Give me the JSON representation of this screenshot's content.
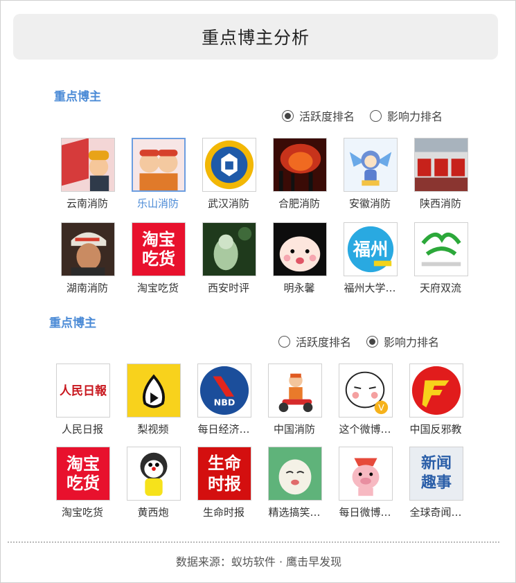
{
  "header": {
    "title": "重点博主分析"
  },
  "section1": {
    "title": "重点博主",
    "radios": [
      {
        "label": "活跃度排名",
        "checked": true
      },
      {
        "label": "影响力排名",
        "checked": false
      }
    ],
    "items": [
      {
        "name": "云南消防",
        "icon": "firefighter-cartoon-icon",
        "active": false
      },
      {
        "name": "乐山消防",
        "icon": "firefighter-mascots-icon",
        "active": true
      },
      {
        "name": "武汉消防",
        "icon": "wuhan-fire-badge-icon",
        "active": false
      },
      {
        "name": "合肥消防",
        "icon": "fire-scene-photo-icon",
        "active": false
      },
      {
        "name": "安徽消防",
        "icon": "blue-mascot-icon",
        "active": false
      },
      {
        "name": "陕西消防",
        "icon": "fire-trucks-photo-icon",
        "active": false
      },
      {
        "name": "湖南消防",
        "icon": "firefighter-portrait-icon",
        "active": false
      },
      {
        "name": "淘宝吃货",
        "icon": "taobao-chihuo-logo-icon",
        "active": false
      },
      {
        "name": "西安时评",
        "icon": "jade-buddha-icon",
        "active": false
      },
      {
        "name": "明永馨",
        "icon": "cartoon-face-icon",
        "active": false
      },
      {
        "name": "福州大学…",
        "icon": "fuzhou-logo-icon",
        "active": false
      },
      {
        "name": "天府双流",
        "icon": "shuangliu-logo-icon",
        "active": false
      }
    ]
  },
  "section2": {
    "title": "重点博主",
    "radios": [
      {
        "label": "活跃度排名",
        "checked": false
      },
      {
        "label": "影响力排名",
        "checked": true
      }
    ],
    "items": [
      {
        "name": "人民日报",
        "icon": "peoples-daily-logo-icon"
      },
      {
        "name": "梨视频",
        "icon": "pear-video-logo-icon"
      },
      {
        "name": "每日经济…",
        "icon": "nbd-logo-icon"
      },
      {
        "name": "中国消防",
        "icon": "firefighter-scooter-icon"
      },
      {
        "name": "这个微博…",
        "icon": "cartoon-face-v-icon"
      },
      {
        "name": "中国反邪教",
        "icon": "anti-cult-logo-icon"
      },
      {
        "name": "淘宝吃货",
        "icon": "taobao-chihuo-logo-icon"
      },
      {
        "name": "黄西炮",
        "icon": "doraemon-icon"
      },
      {
        "name": "生命时报",
        "icon": "life-times-logo-icon"
      },
      {
        "name": "精选搞笑…",
        "icon": "funny-cartoon-icon"
      },
      {
        "name": "每日微博…",
        "icon": "pig-cartoon-icon"
      },
      {
        "name": "全球奇闻…",
        "icon": "strange-news-logo-icon"
      }
    ],
    "logo_text": {
      "taobao_1": "淘宝",
      "taobao_2": "吃货",
      "nbd": "NBD",
      "life_1": "生命",
      "life_2": "时报",
      "news_1": "新闻",
      "news_2": "趣事",
      "peoples_daily": "人民日報"
    }
  },
  "footer": {
    "text": "数据来源：蚁坊软件 · 鹰击早发现"
  },
  "colors": {
    "accent": "#4a8ad6",
    "header_bg": "#efefef",
    "taobao_red": "#e8112d"
  }
}
